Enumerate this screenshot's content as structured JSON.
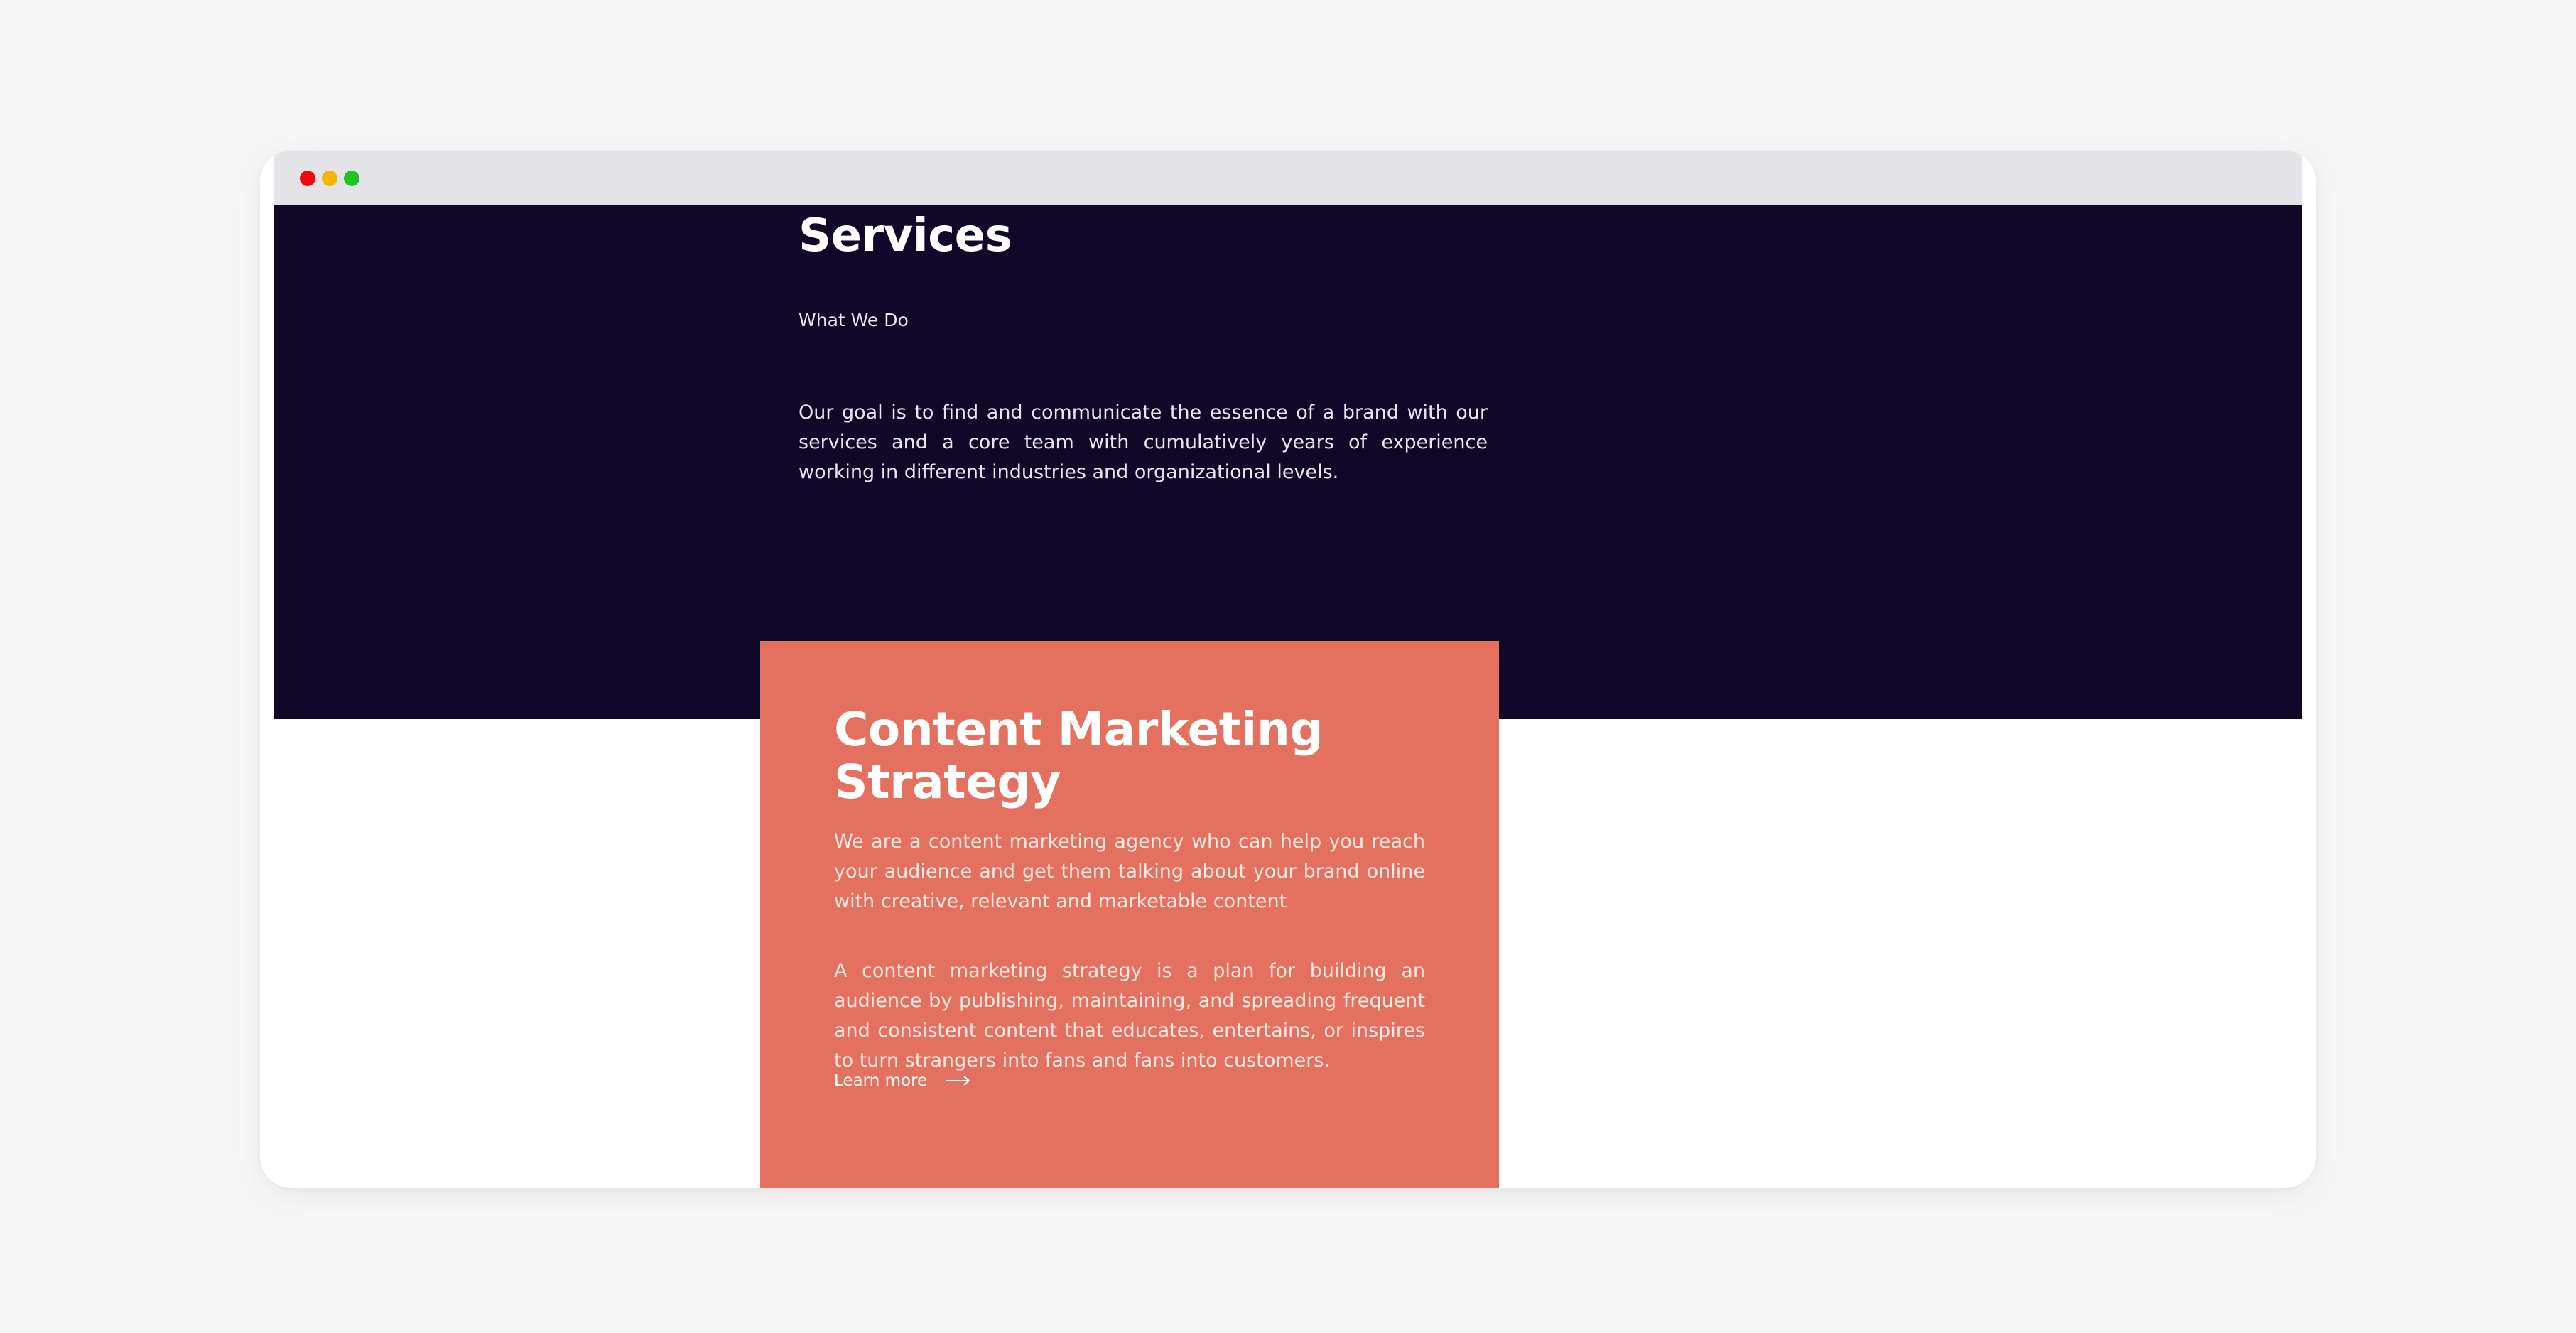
{
  "window": {
    "controls": [
      "close",
      "minimize",
      "maximize"
    ]
  },
  "hero": {
    "title": "Services",
    "subtitle": "What We Do",
    "description": "Our goal is to find and communicate the essence of a brand with our services and a core team with cumulatively years of experience working in different industries and organizational levels."
  },
  "card": {
    "title": "Content Marketing Strategy",
    "paragraph1": "We are a content marketing agency who can help you reach your audience and get them talking about your brand online with creative, relevant and marketable content",
    "paragraph2": "A content marketing strategy is a plan for building an audience by publishing, maintaining, and spreading frequent and consistent content that educates, entertains, or inspires to turn strangers into fans and fans into customers.",
    "link_label": "Learn more",
    "link_icon": "long-arrow-right-icon"
  },
  "colors": {
    "page_background": "#f6f7f6",
    "titlebar": "#e4e3e8",
    "hero_background": "#110729",
    "card_background": "#e4705f",
    "close_dot": "#ee0b0b",
    "minimize_dot": "#f5b500",
    "maximize_dot": "#22c31f"
  }
}
